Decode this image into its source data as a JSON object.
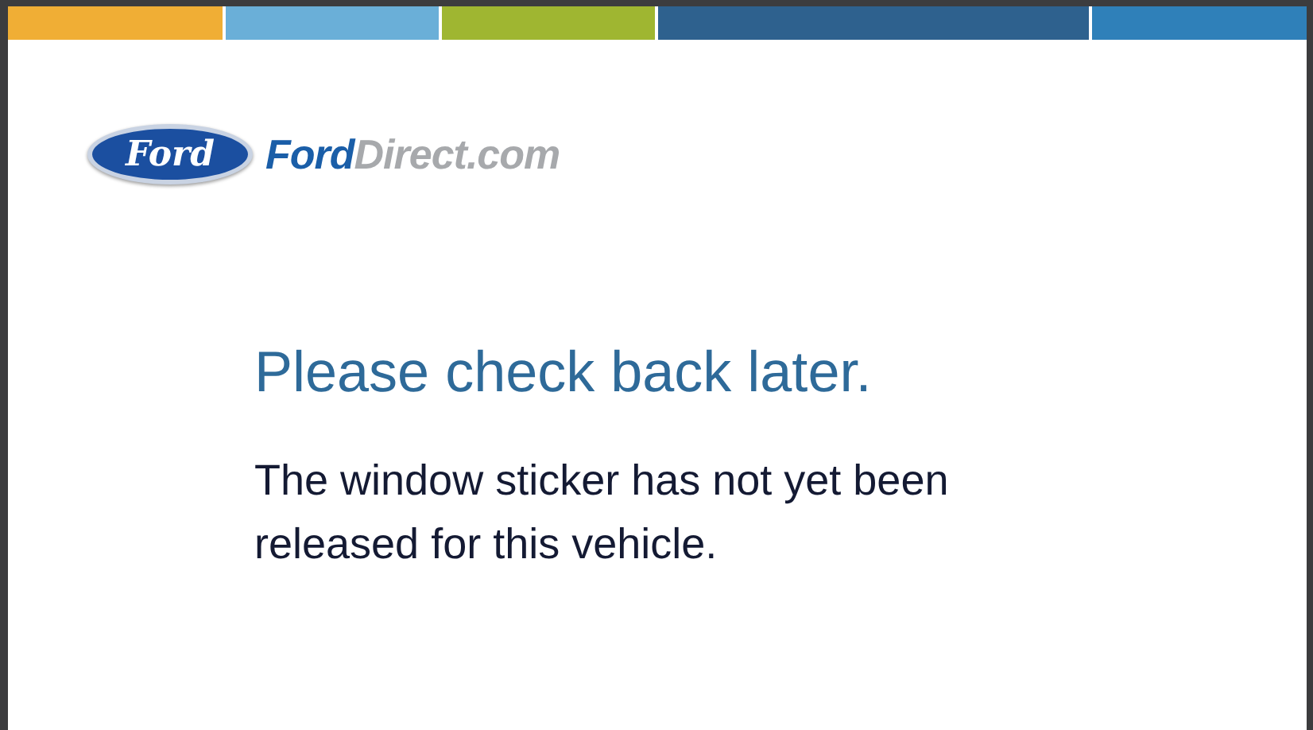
{
  "color_bar": [
    {
      "color": "#f0ae35"
    },
    {
      "color": "#6aafd8"
    },
    {
      "color": "#9fb631"
    },
    {
      "color": "#2e618e"
    },
    {
      "color": "#2f80b9"
    }
  ],
  "logo": {
    "emblem": "Ford",
    "brand": "Ford",
    "suffix": "Direct.com"
  },
  "heading": "Please check back later.",
  "message": "The window sticker has not yet been released for this vehicle."
}
